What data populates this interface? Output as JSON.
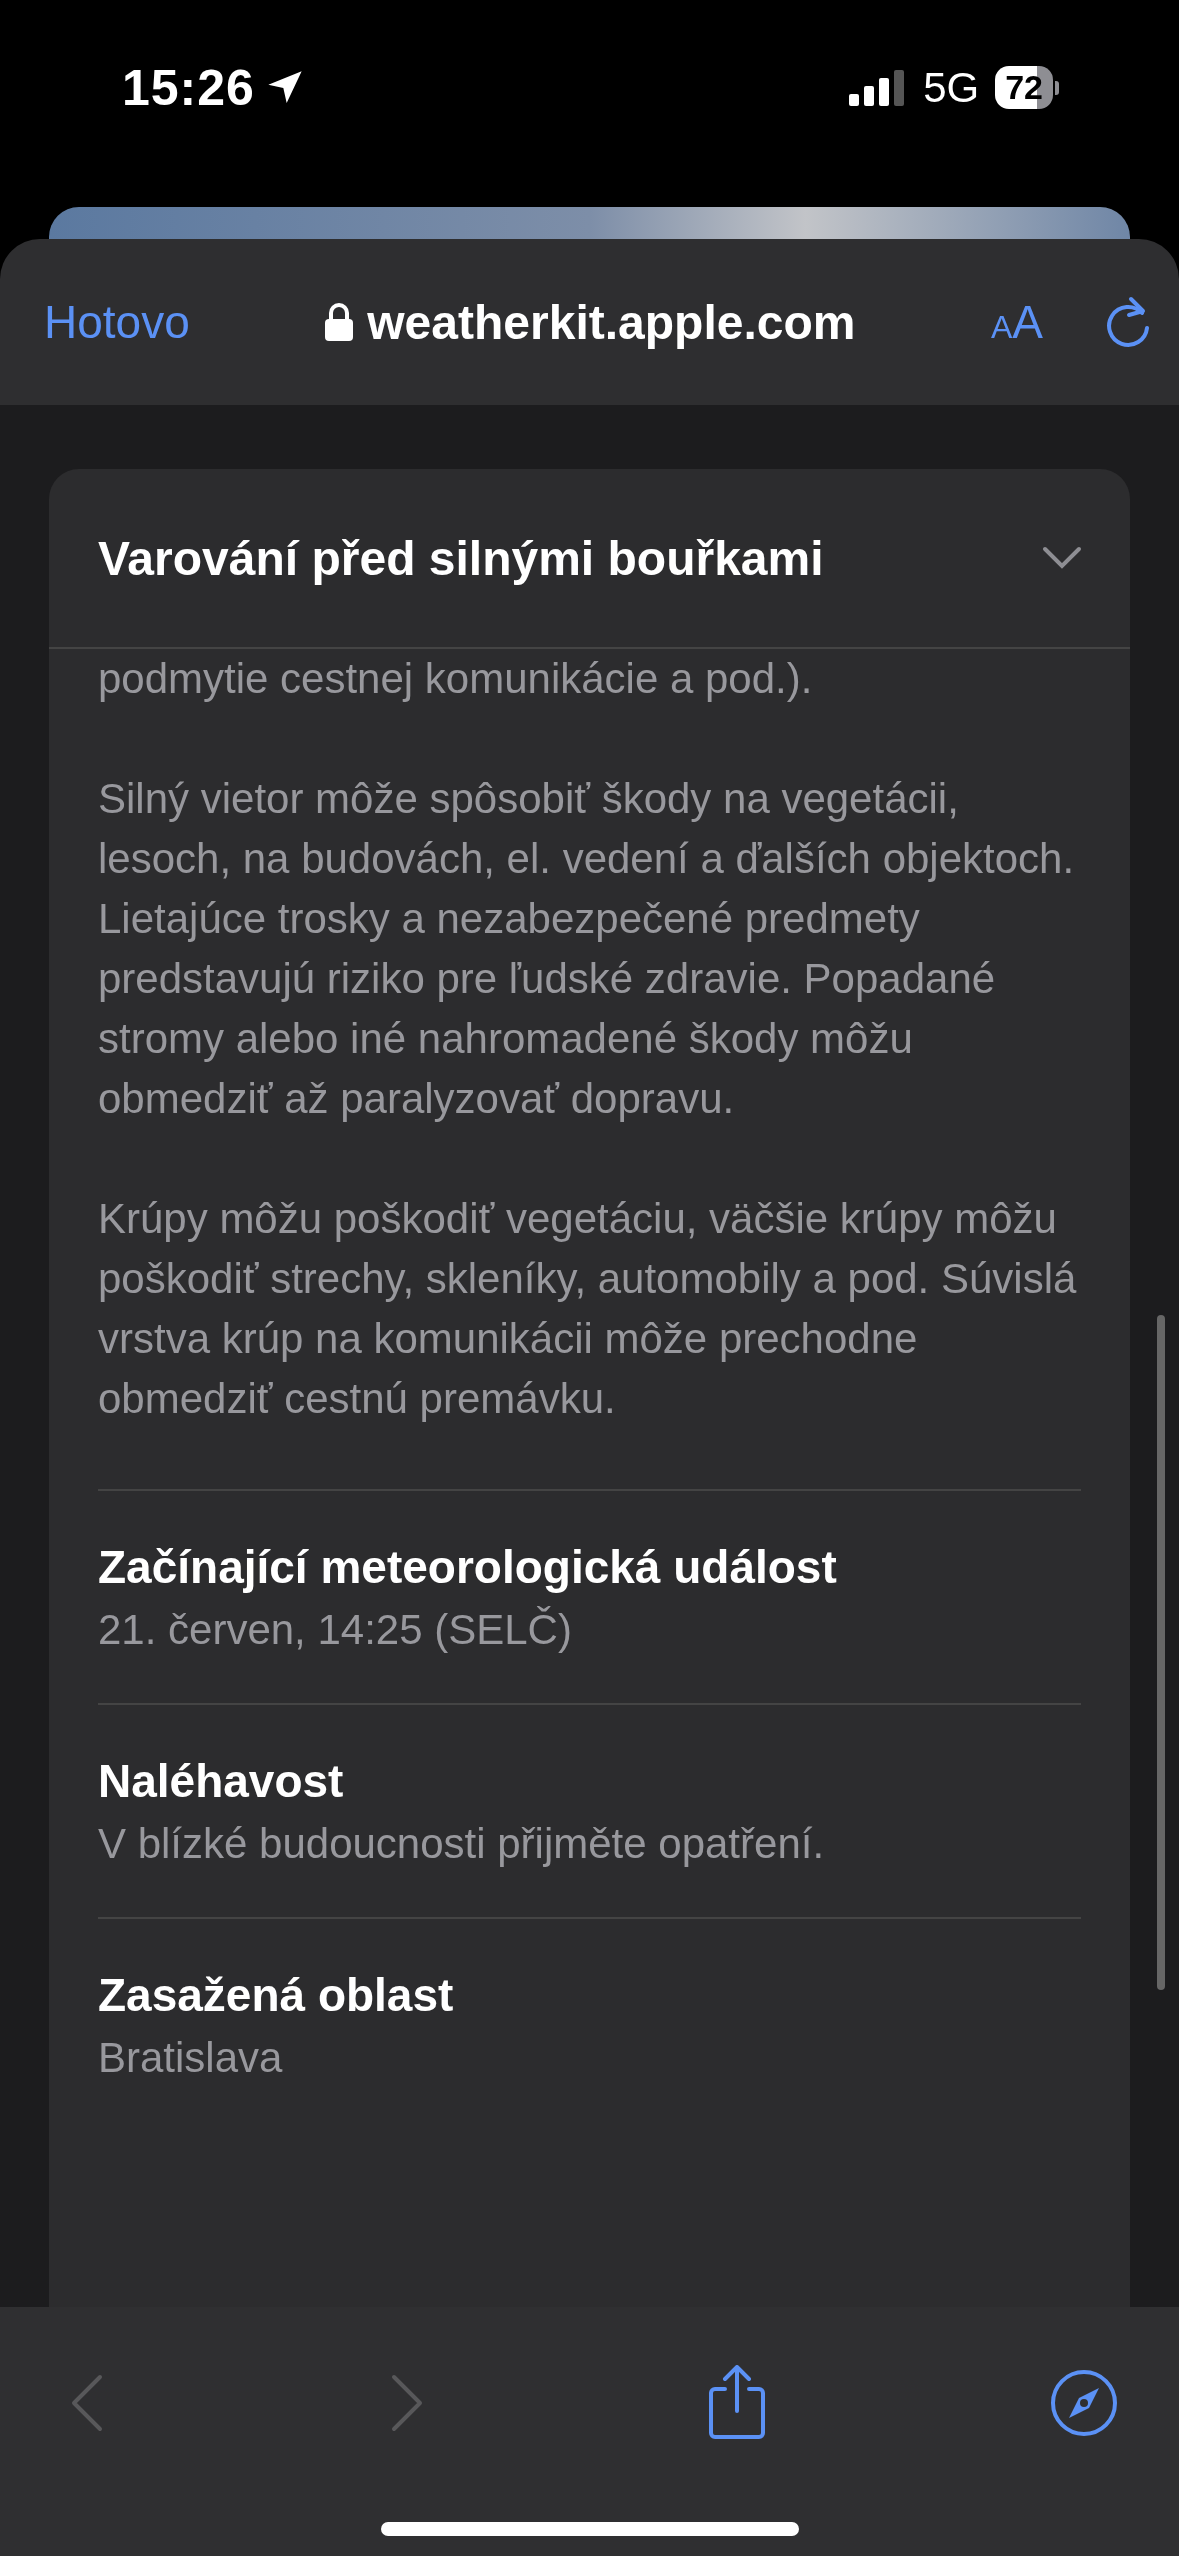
{
  "status_bar": {
    "time": "15:26",
    "network": "5G",
    "battery": "72"
  },
  "browser_bar": {
    "done": "Hotovo",
    "url": "weatherkit.apple.com",
    "text_size": "AA"
  },
  "alert": {
    "title": "Varování před silnými bouřkami",
    "paragraphs": [
      "podmytie cestnej komunikácie a pod.).",
      "Silný vietor môže spôsobiť škody na vegetácii, lesoch, na budovách, el. vedení a ďalších objektoch. Lietajúce trosky a nezabezpečené predmety predstavujú riziko pre ľudské zdravie. Popadané stromy alebo iné nahromadené škody môžu obmedziť až paralyzovať dopravu.",
      "Krúpy môžu poškodiť vegetáciu, väčšie krúpy môžu poškodiť strechy, skleníky, automobily a pod. Súvislá vrstva krúp na komunikácii môže prechodne obmedziť cestnú premávku."
    ],
    "details": [
      {
        "label": "Začínající meteorologická událost",
        "value": "21. červen, 14:25 (SELČ)"
      },
      {
        "label": "Naléhavost",
        "value": "V blízké budoucnosti přijměte opatření."
      },
      {
        "label": "Zasažená oblast",
        "value": "Bratislava"
      }
    ]
  },
  "toolbar": {
    "back": {
      "disabled": true
    },
    "forward": {
      "disabled": true
    }
  }
}
